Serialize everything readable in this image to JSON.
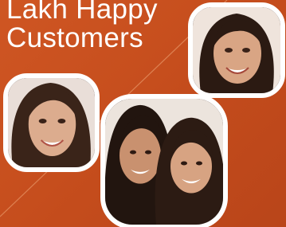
{
  "headline": {
    "line1": "Lakh Happy",
    "line2": "Customers"
  },
  "colors": {
    "background": "#c8501f",
    "frame": "#ffffff",
    "text": "#ffffff"
  },
  "images": [
    "smiling-woman-portrait",
    "smiling-woman-portrait",
    "two-smiling-women-portrait"
  ]
}
